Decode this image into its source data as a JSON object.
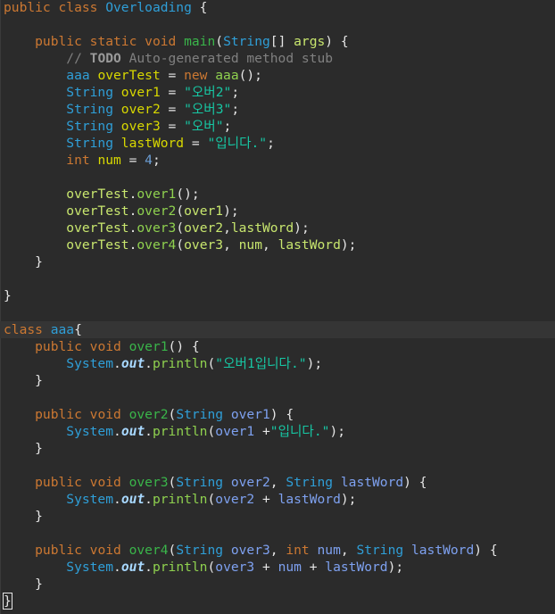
{
  "lines": [
    {
      "t": [
        [
          "public ",
          "kw"
        ],
        [
          "class ",
          "kw"
        ],
        [
          "Overloading ",
          "cls"
        ],
        [
          "{",
          "p"
        ]
      ]
    },
    {
      "t": []
    },
    {
      "t": [
        [
          "    public ",
          "kw"
        ],
        [
          "static ",
          "kw"
        ],
        [
          "void ",
          "kw"
        ],
        [
          "main",
          "fn"
        ],
        [
          "(",
          "p"
        ],
        [
          "String",
          "type"
        ],
        [
          "[] ",
          "p"
        ],
        [
          "args",
          "ref"
        ],
        [
          ") {",
          "p"
        ]
      ]
    },
    {
      "t": [
        [
          "        // ",
          "cm"
        ],
        [
          "TODO",
          "todo"
        ],
        [
          " Auto-generated method stub",
          "cm"
        ]
      ]
    },
    {
      "t": [
        [
          "        aaa ",
          "cls"
        ],
        [
          "overTest",
          "var"
        ],
        [
          " = ",
          "p"
        ],
        [
          "new ",
          "kw"
        ],
        [
          "aaa",
          "call"
        ],
        [
          "();",
          "p"
        ]
      ]
    },
    {
      "t": [
        [
          "        String ",
          "type"
        ],
        [
          "over1",
          "var"
        ],
        [
          " = ",
          "p"
        ],
        [
          "\"오버2\"",
          "str"
        ],
        [
          ";",
          "p"
        ]
      ]
    },
    {
      "t": [
        [
          "        String ",
          "type"
        ],
        [
          "over2",
          "var"
        ],
        [
          " = ",
          "p"
        ],
        [
          "\"오버3\"",
          "str"
        ],
        [
          ";",
          "p"
        ]
      ]
    },
    {
      "t": [
        [
          "        String ",
          "type"
        ],
        [
          "over3",
          "var"
        ],
        [
          " = ",
          "p"
        ],
        [
          "\"오버\"",
          "str"
        ],
        [
          ";",
          "p"
        ]
      ]
    },
    {
      "t": [
        [
          "        String ",
          "type"
        ],
        [
          "lastWord",
          "var"
        ],
        [
          " = ",
          "p"
        ],
        [
          "\"입니다.\"",
          "str"
        ],
        [
          ";",
          "p"
        ]
      ]
    },
    {
      "t": [
        [
          "        int ",
          "kw"
        ],
        [
          "num",
          "var"
        ],
        [
          " = ",
          "p"
        ],
        [
          "4",
          "num"
        ],
        [
          ";",
          "p"
        ]
      ]
    },
    {
      "t": []
    },
    {
      "t": [
        [
          "        overTest",
          "ref"
        ],
        [
          ".",
          "p"
        ],
        [
          "over1",
          "call"
        ],
        [
          "();",
          "p"
        ]
      ]
    },
    {
      "t": [
        [
          "        overTest",
          "ref"
        ],
        [
          ".",
          "p"
        ],
        [
          "over2",
          "call"
        ],
        [
          "(",
          "p"
        ],
        [
          "over1",
          "ref"
        ],
        [
          ");",
          "p"
        ]
      ]
    },
    {
      "t": [
        [
          "        overTest",
          "ref"
        ],
        [
          ".",
          "p"
        ],
        [
          "over3",
          "call"
        ],
        [
          "(",
          "p"
        ],
        [
          "over2",
          "ref"
        ],
        [
          ",",
          "p"
        ],
        [
          "lastWord",
          "ref"
        ],
        [
          ");",
          "p"
        ]
      ]
    },
    {
      "t": [
        [
          "        overTest",
          "ref"
        ],
        [
          ".",
          "p"
        ],
        [
          "over4",
          "call"
        ],
        [
          "(",
          "p"
        ],
        [
          "over3",
          "ref"
        ],
        [
          ", ",
          "p"
        ],
        [
          "num",
          "ref"
        ],
        [
          ", ",
          "p"
        ],
        [
          "lastWord",
          "ref"
        ],
        [
          ");",
          "p"
        ]
      ]
    },
    {
      "t": [
        [
          "    }",
          "p"
        ]
      ]
    },
    {
      "t": []
    },
    {
      "t": [
        [
          "}",
          "p"
        ]
      ]
    },
    {
      "t": []
    },
    {
      "t": [
        [
          "class ",
          "kw"
        ],
        [
          "aaa",
          "cls"
        ],
        [
          "{",
          "p"
        ]
      ],
      "hl": true
    },
    {
      "t": [
        [
          "    public ",
          "kw"
        ],
        [
          "void ",
          "kw"
        ],
        [
          "over1",
          "fn"
        ],
        [
          "() {",
          "p"
        ]
      ]
    },
    {
      "t": [
        [
          "        System",
          "type"
        ],
        [
          ".",
          "p"
        ],
        [
          "out",
          "out"
        ],
        [
          ".",
          "p"
        ],
        [
          "println",
          "call"
        ],
        [
          "(",
          "p"
        ],
        [
          "\"오버1입니다.\"",
          "str"
        ],
        [
          ");",
          "p"
        ]
      ]
    },
    {
      "t": [
        [
          "    }",
          "p"
        ]
      ]
    },
    {
      "t": []
    },
    {
      "t": [
        [
          "    public ",
          "kw"
        ],
        [
          "void ",
          "kw"
        ],
        [
          "over2",
          "fn"
        ],
        [
          "(",
          "p"
        ],
        [
          "String ",
          "type"
        ],
        [
          "over1",
          "param"
        ],
        [
          ") {",
          "p"
        ]
      ]
    },
    {
      "t": [
        [
          "        System",
          "type"
        ],
        [
          ".",
          "p"
        ],
        [
          "out",
          "out"
        ],
        [
          ".",
          "p"
        ],
        [
          "println",
          "call"
        ],
        [
          "(",
          "p"
        ],
        [
          "over1",
          "param"
        ],
        [
          " +",
          "p"
        ],
        [
          "\"입니다.\"",
          "str"
        ],
        [
          ");",
          "p"
        ]
      ]
    },
    {
      "t": [
        [
          "    }",
          "p"
        ]
      ]
    },
    {
      "t": []
    },
    {
      "t": [
        [
          "    public ",
          "kw"
        ],
        [
          "void ",
          "kw"
        ],
        [
          "over3",
          "fn"
        ],
        [
          "(",
          "p"
        ],
        [
          "String ",
          "type"
        ],
        [
          "over2",
          "param"
        ],
        [
          ", ",
          "p"
        ],
        [
          "String ",
          "type"
        ],
        [
          "lastWord",
          "param"
        ],
        [
          ") {",
          "p"
        ]
      ]
    },
    {
      "t": [
        [
          "        System",
          "type"
        ],
        [
          ".",
          "p"
        ],
        [
          "out",
          "out"
        ],
        [
          ".",
          "p"
        ],
        [
          "println",
          "call"
        ],
        [
          "(",
          "p"
        ],
        [
          "over2",
          "param"
        ],
        [
          " + ",
          "p"
        ],
        [
          "lastWord",
          "param"
        ],
        [
          ");",
          "p"
        ]
      ]
    },
    {
      "t": [
        [
          "    }",
          "p"
        ]
      ]
    },
    {
      "t": []
    },
    {
      "t": [
        [
          "    public ",
          "kw"
        ],
        [
          "void ",
          "kw"
        ],
        [
          "over4",
          "fn"
        ],
        [
          "(",
          "p"
        ],
        [
          "String ",
          "type"
        ],
        [
          "over3",
          "param"
        ],
        [
          ", ",
          "p"
        ],
        [
          "int ",
          "kw"
        ],
        [
          "num",
          "param"
        ],
        [
          ", ",
          "p"
        ],
        [
          "String ",
          "type"
        ],
        [
          "lastWord",
          "param"
        ],
        [
          ") {",
          "p"
        ]
      ]
    },
    {
      "t": [
        [
          "        System",
          "type"
        ],
        [
          ".",
          "p"
        ],
        [
          "out",
          "out"
        ],
        [
          ".",
          "p"
        ],
        [
          "println",
          "call"
        ],
        [
          "(",
          "p"
        ],
        [
          "over3",
          "param"
        ],
        [
          " + ",
          "p"
        ],
        [
          "num",
          "param"
        ],
        [
          " + ",
          "p"
        ],
        [
          "lastWord",
          "param"
        ],
        [
          ");",
          "p"
        ]
      ]
    },
    {
      "t": [
        [
          "    }",
          "p"
        ]
      ]
    },
    {
      "t": [
        [
          "}",
          "p caret"
        ]
      ]
    }
  ]
}
